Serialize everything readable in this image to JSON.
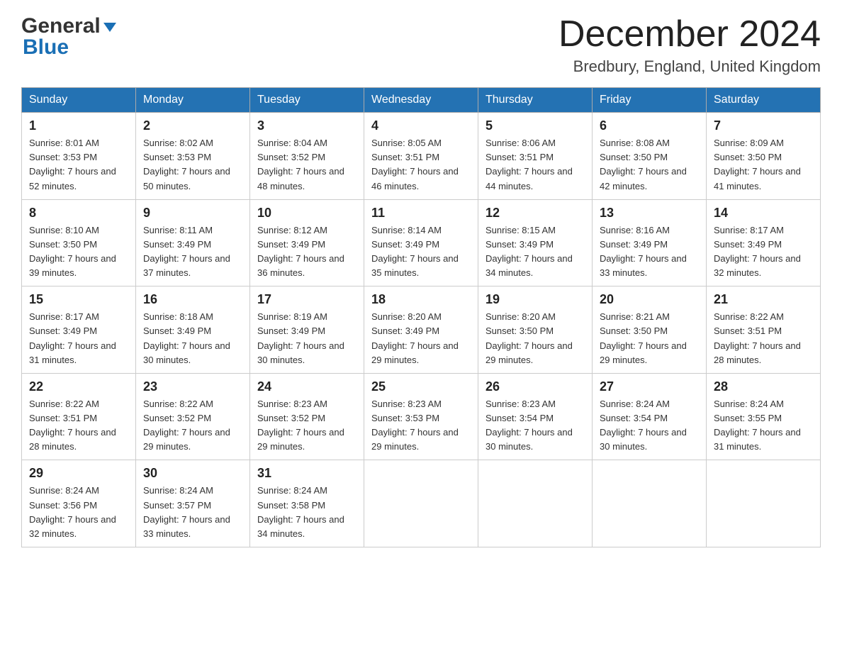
{
  "header": {
    "logo_general": "General",
    "logo_blue": "Blue",
    "month_title": "December 2024",
    "location": "Bredbury, England, United Kingdom"
  },
  "weekdays": [
    "Sunday",
    "Monday",
    "Tuesday",
    "Wednesday",
    "Thursday",
    "Friday",
    "Saturday"
  ],
  "weeks": [
    [
      {
        "day": 1,
        "sunrise": "8:01 AM",
        "sunset": "3:53 PM",
        "daylight": "7 hours and 52 minutes."
      },
      {
        "day": 2,
        "sunrise": "8:02 AM",
        "sunset": "3:53 PM",
        "daylight": "7 hours and 50 minutes."
      },
      {
        "day": 3,
        "sunrise": "8:04 AM",
        "sunset": "3:52 PM",
        "daylight": "7 hours and 48 minutes."
      },
      {
        "day": 4,
        "sunrise": "8:05 AM",
        "sunset": "3:51 PM",
        "daylight": "7 hours and 46 minutes."
      },
      {
        "day": 5,
        "sunrise": "8:06 AM",
        "sunset": "3:51 PM",
        "daylight": "7 hours and 44 minutes."
      },
      {
        "day": 6,
        "sunrise": "8:08 AM",
        "sunset": "3:50 PM",
        "daylight": "7 hours and 42 minutes."
      },
      {
        "day": 7,
        "sunrise": "8:09 AM",
        "sunset": "3:50 PM",
        "daylight": "7 hours and 41 minutes."
      }
    ],
    [
      {
        "day": 8,
        "sunrise": "8:10 AM",
        "sunset": "3:50 PM",
        "daylight": "7 hours and 39 minutes."
      },
      {
        "day": 9,
        "sunrise": "8:11 AM",
        "sunset": "3:49 PM",
        "daylight": "7 hours and 37 minutes."
      },
      {
        "day": 10,
        "sunrise": "8:12 AM",
        "sunset": "3:49 PM",
        "daylight": "7 hours and 36 minutes."
      },
      {
        "day": 11,
        "sunrise": "8:14 AM",
        "sunset": "3:49 PM",
        "daylight": "7 hours and 35 minutes."
      },
      {
        "day": 12,
        "sunrise": "8:15 AM",
        "sunset": "3:49 PM",
        "daylight": "7 hours and 34 minutes."
      },
      {
        "day": 13,
        "sunrise": "8:16 AM",
        "sunset": "3:49 PM",
        "daylight": "7 hours and 33 minutes."
      },
      {
        "day": 14,
        "sunrise": "8:17 AM",
        "sunset": "3:49 PM",
        "daylight": "7 hours and 32 minutes."
      }
    ],
    [
      {
        "day": 15,
        "sunrise": "8:17 AM",
        "sunset": "3:49 PM",
        "daylight": "7 hours and 31 minutes."
      },
      {
        "day": 16,
        "sunrise": "8:18 AM",
        "sunset": "3:49 PM",
        "daylight": "7 hours and 30 minutes."
      },
      {
        "day": 17,
        "sunrise": "8:19 AM",
        "sunset": "3:49 PM",
        "daylight": "7 hours and 30 minutes."
      },
      {
        "day": 18,
        "sunrise": "8:20 AM",
        "sunset": "3:49 PM",
        "daylight": "7 hours and 29 minutes."
      },
      {
        "day": 19,
        "sunrise": "8:20 AM",
        "sunset": "3:50 PM",
        "daylight": "7 hours and 29 minutes."
      },
      {
        "day": 20,
        "sunrise": "8:21 AM",
        "sunset": "3:50 PM",
        "daylight": "7 hours and 29 minutes."
      },
      {
        "day": 21,
        "sunrise": "8:22 AM",
        "sunset": "3:51 PM",
        "daylight": "7 hours and 28 minutes."
      }
    ],
    [
      {
        "day": 22,
        "sunrise": "8:22 AM",
        "sunset": "3:51 PM",
        "daylight": "7 hours and 28 minutes."
      },
      {
        "day": 23,
        "sunrise": "8:22 AM",
        "sunset": "3:52 PM",
        "daylight": "7 hours and 29 minutes."
      },
      {
        "day": 24,
        "sunrise": "8:23 AM",
        "sunset": "3:52 PM",
        "daylight": "7 hours and 29 minutes."
      },
      {
        "day": 25,
        "sunrise": "8:23 AM",
        "sunset": "3:53 PM",
        "daylight": "7 hours and 29 minutes."
      },
      {
        "day": 26,
        "sunrise": "8:23 AM",
        "sunset": "3:54 PM",
        "daylight": "7 hours and 30 minutes."
      },
      {
        "day": 27,
        "sunrise": "8:24 AM",
        "sunset": "3:54 PM",
        "daylight": "7 hours and 30 minutes."
      },
      {
        "day": 28,
        "sunrise": "8:24 AM",
        "sunset": "3:55 PM",
        "daylight": "7 hours and 31 minutes."
      }
    ],
    [
      {
        "day": 29,
        "sunrise": "8:24 AM",
        "sunset": "3:56 PM",
        "daylight": "7 hours and 32 minutes."
      },
      {
        "day": 30,
        "sunrise": "8:24 AM",
        "sunset": "3:57 PM",
        "daylight": "7 hours and 33 minutes."
      },
      {
        "day": 31,
        "sunrise": "8:24 AM",
        "sunset": "3:58 PM",
        "daylight": "7 hours and 34 minutes."
      },
      null,
      null,
      null,
      null
    ]
  ]
}
